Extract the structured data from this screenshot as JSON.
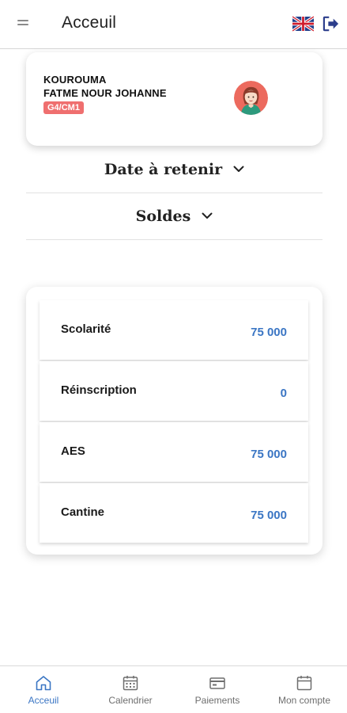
{
  "header": {
    "title": "Acceuil",
    "menu_icon": "hamburger-icon",
    "language_icon": "uk-flag-icon",
    "logout_icon": "logout-icon"
  },
  "student": {
    "last_name": "KOUROUMA",
    "first_name": "FATME NOUR JOHANNE",
    "class": "G4/CM1",
    "avatar_icon": "student-avatar-icon"
  },
  "sections": [
    {
      "label": "Date à retenir",
      "icon": "chevron-down-icon"
    },
    {
      "label": "Soldes",
      "icon": "chevron-down-icon"
    }
  ],
  "balances": [
    {
      "label": "Scolarité",
      "amount": "75 000"
    },
    {
      "label": "Réinscription",
      "amount": "0"
    },
    {
      "label": "AES",
      "amount": "75 000"
    },
    {
      "label": "Cantine",
      "amount": "75 000"
    }
  ],
  "nav": [
    {
      "label": "Acceuil",
      "icon": "home-icon",
      "active": true
    },
    {
      "label": "Calendrier",
      "icon": "calendar-icon",
      "active": false
    },
    {
      "label": "Paiements",
      "icon": "card-icon",
      "active": false
    },
    {
      "label": "Mon compte",
      "icon": "account-icon",
      "active": false
    }
  ],
  "colors": {
    "accent": "#3b76c4",
    "badge": "#ef6f6f",
    "nav_inactive": "#6e6e6e"
  }
}
